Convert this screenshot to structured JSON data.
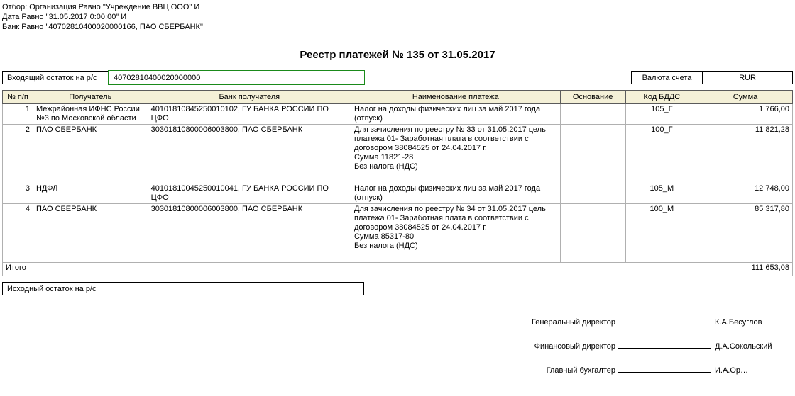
{
  "meta": {
    "filter_line_1": "Отбор: Организация Равно \"Учреждение ВВЦ ООО\" И",
    "filter_line_2": "Дата Равно \"31.05.2017 0:00:00\" И",
    "filter_line_3": "Банк Равно \"40702810400020000166, ПАО СБЕРБАНК\""
  },
  "title": "Реестр платежей № 135 от 31.05.2017",
  "balance_in_label": "Входящий остаток на р/с",
  "balance_in_value": "40702810400020000000",
  "currency_label": "Валюта счета",
  "currency_value": "RUR",
  "headers": {
    "num": "№ п/п",
    "recipient": "Получатель",
    "bank": "Банк получателя",
    "payment": "Наименование платежа",
    "basis": "Основание",
    "code": "Код БДДС",
    "sum": "Сумма"
  },
  "rows": [
    {
      "num": "1",
      "recipient": "Межрайонная ИФНС России №3 по Московской области",
      "bank": "40101810845250010102, ГУ БАНКА РОССИИ ПО ЦФО",
      "payment": "Налог на доходы физических лиц за май 2017 года (отпуск)",
      "basis": "",
      "code": "105_Г",
      "sum": "1 766,00"
    },
    {
      "num": "2",
      "recipient": "ПАО СБЕРБАНК",
      "bank": "30301810800006003800, ПАО СБЕРБАНК",
      "payment": "Для зачисления по реестру № 33 от 31.05.2017 цель платежа 01- Заработная плата в соответствии с договором 38084525 от 24.04.2017 г.\nСумма 11821-28\nБез налога (НДС)",
      "basis": "",
      "code": "100_Г",
      "sum": "11 821,28"
    },
    {
      "num": "3",
      "recipient": "НДФЛ",
      "bank": "40101810045250010041, ГУ БАНКА РОССИИ ПО ЦФО",
      "payment": "Налог на доходы физических лиц за май 2017 года (отпуск)",
      "basis": "",
      "code": "105_М",
      "sum": "12 748,00"
    },
    {
      "num": "4",
      "recipient": "ПАО СБЕРБАНК",
      "bank": "30301810800006003800, ПАО СБЕРБАНК",
      "payment": "Для зачисления по реестру № 34 от 31.05.2017 цель платежа 01- Заработная плата в соответствии с договором 38084525 от 24.04.2017 г.\nСумма 85317-80\nБез налога (НДС)",
      "basis": "",
      "code": "100_М",
      "sum": "85 317,80"
    }
  ],
  "total_label": "Итого",
  "total_sum": "111 653,08",
  "balance_out_label": "Исходный остаток на р/с",
  "balance_out_value": "",
  "signatures": [
    {
      "role": "Генеральный директор",
      "name": "К.А.Бесуглов"
    },
    {
      "role": "Финансовый директор",
      "name": "Д.А.Сокольский"
    },
    {
      "role": "Главный бухгалтер",
      "name": "И.А.Ор…"
    }
  ]
}
